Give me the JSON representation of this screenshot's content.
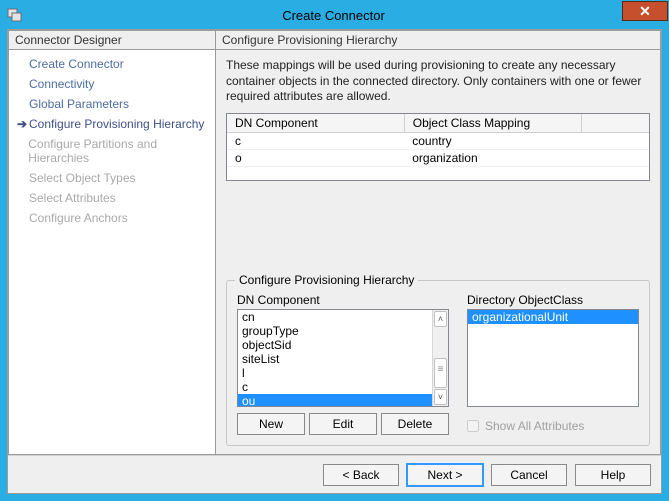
{
  "window": {
    "title": "Create Connector"
  },
  "left_panel": {
    "header": "Connector Designer",
    "items": [
      {
        "label": "Create Connector",
        "state": "enabled"
      },
      {
        "label": "Connectivity",
        "state": "enabled"
      },
      {
        "label": "Global Parameters",
        "state": "enabled"
      },
      {
        "label": "Configure Provisioning Hierarchy",
        "state": "active"
      },
      {
        "label": "Configure Partitions and Hierarchies",
        "state": "disabled"
      },
      {
        "label": "Select Object Types",
        "state": "disabled"
      },
      {
        "label": "Select Attributes",
        "state": "disabled"
      },
      {
        "label": "Configure Anchors",
        "state": "disabled"
      }
    ]
  },
  "right_panel": {
    "header": "Configure Provisioning Hierarchy",
    "instructions": "These mappings will be used during provisioning to create any necessary container objects in the connected directory.  Only containers with one or fewer required attributes are allowed.",
    "grid": {
      "col1": "DN Component",
      "col2": "Object Class Mapping",
      "rows": [
        {
          "dn": "c",
          "cls": "country"
        },
        {
          "dn": "o",
          "cls": "organization"
        }
      ]
    },
    "group": {
      "legend": "Configure Provisioning Hierarchy",
      "dn_label": "DN Component",
      "dn_items": [
        "cn",
        "groupType",
        "objectSid",
        "siteList",
        "l",
        "c",
        "ou"
      ],
      "dn_selected": "ou",
      "objclass_label": "Directory ObjectClass",
      "objclass_items": [
        "organizationalUnit"
      ],
      "objclass_selected": "organizationalUnit",
      "buttons": {
        "new": "New",
        "edit": "Edit",
        "delete": "Delete"
      },
      "show_all_label": "Show All Attributes",
      "show_all_checked": false
    }
  },
  "wizard_buttons": {
    "back": "< Back",
    "next": "Next >",
    "cancel": "Cancel",
    "help": "Help"
  }
}
